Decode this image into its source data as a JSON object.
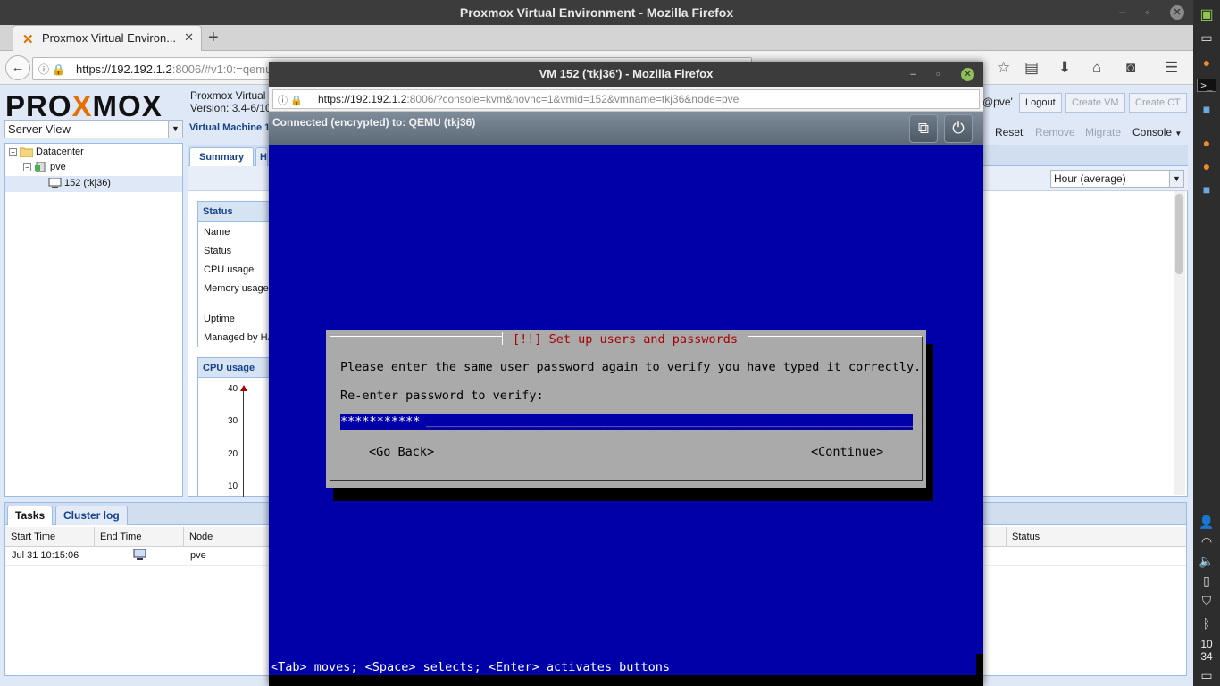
{
  "main_window": {
    "title": "Proxmox Virtual Environment - Mozilla Firefox",
    "minimize": "–",
    "maximize": "◦",
    "close": "✕"
  },
  "main_tab": {
    "title": "Proxmox Virtual Environ...",
    "close": "✕",
    "new_tab": "+"
  },
  "main_nav": {
    "url_host": "https://192.192.1.2",
    "url_rest": ":8006/#v1:0:=qemu%",
    "back": "←",
    "info_icon": "ⓘ",
    "lock_icon": "🔒"
  },
  "proxmox": {
    "logo_pre": "PRO",
    "logo_x": "X",
    "logo_post": "MOX",
    "version_line1": "Proxmox Virtual",
    "version_line2": "Version: 3.4-6/10",
    "user": "@pve'",
    "logout": "Logout",
    "create_vm": "Create VM",
    "create_ct": "Create CT",
    "server_view": "Server View",
    "tree": {
      "datacenter": "Datacenter",
      "node": "pve",
      "vm": "152 (tkj36)"
    },
    "content_title": "Virtual Machine 1",
    "toolbar": {
      "reset": "Reset",
      "remove": "Remove",
      "migrate": "Migrate",
      "console": "Console"
    },
    "tabs": [
      "Summary",
      "H"
    ],
    "timeframe": "Hour (average)",
    "status_panel": {
      "title": "Status",
      "rows": [
        "Name",
        "Status",
        "CPU usage",
        "Memory usage",
        "Uptime",
        "Managed by HA"
      ]
    },
    "cpu_panel": {
      "title": "CPU usage",
      "ticks": [
        "40",
        "30",
        "20",
        "10"
      ]
    },
    "bottom": {
      "tabs": [
        "Tasks",
        "Cluster log"
      ],
      "columns": [
        "Start Time",
        "End Time",
        "Node",
        "Status"
      ],
      "row": {
        "start": "Jul 31 10:15:06",
        "node": "pve"
      }
    }
  },
  "dock": {
    "clock_hour": "10",
    "clock_min": "34"
  },
  "popup": {
    "title": "VM 152 ('tkj36') - Mozilla Firefox",
    "url_host": "https://192.192.1.2",
    "url_rest": ":8006/?console=kvm&novnc=1&vmid=152&vmname=tkj36&node=pve",
    "novnc_status": "Connected (encrypted) to: QEMU (tkj36)",
    "close": "✕",
    "minimize": "–",
    "maximize": "▫"
  },
  "installer": {
    "title": "[!!] Set up users and passwords",
    "message": "Please enter the same user password again to verify you have typed it correctly.",
    "prompt": "Re-enter password to verify:",
    "password_mask": "***********",
    "go_back": "<Go Back>",
    "continue": "<Continue>",
    "help": "<Tab> moves; <Space> selects; <Enter> activates buttons"
  },
  "colors": {
    "vnc_bg": "#0000a8",
    "dialog_bg": "#aaaaaa",
    "dialog_title": "#a80000",
    "proxmox_orange": "#e57000",
    "extjs_blue": "#dfe8f6"
  }
}
